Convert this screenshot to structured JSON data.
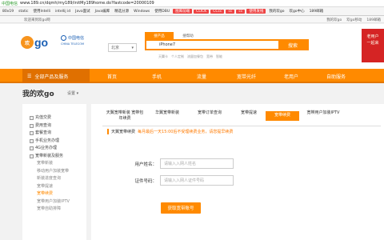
{
  "browser": {
    "secure_label": "中国电信",
    "url": "www.189.cn/dqmh/my189/initMy189home.do?fastcode=20000109",
    "bookmarks": [
      "80x19",
      "static",
      "使用Intelli",
      "intellij id",
      "Java面试",
      "Java编库",
      "精选分源",
      "Windows",
      "使用DBU",
      "图库前端",
      "CLICK",
      "CCcc",
      "cc",
      "cc",
      "使用发线",
      "我的欢go",
      "欢go中心",
      "189邮箱"
    ]
  },
  "topbar": {
    "welcome": "欢迎来到欢go网",
    "links": [
      "我的欢go",
      "欢go移动",
      "189邮箱"
    ]
  },
  "header": {
    "logo_o": "欢",
    "logo_go": "go",
    "carrier_line1": "中国电信",
    "carrier_line2": "CHINA TELECOM",
    "city": "北京",
    "search_tabs": [
      "搜产品",
      "搜帮助"
    ],
    "search_value": "iPhone7",
    "search_button": "搜索",
    "hot_words": [
      "天翼卡",
      "个人定制",
      "流量加餐包",
      "宽带",
      "智能"
    ],
    "promo": [
      "老用户",
      "一起来"
    ]
  },
  "nav": {
    "all_label": "全部产品及服务",
    "items": [
      "首页",
      "手机",
      "流量",
      "宽带光纤",
      "老用户",
      "自助服务"
    ]
  },
  "mygo": {
    "title": "我的欢go",
    "setting": "设置 ▾"
  },
  "sidebar": {
    "items": [
      {
        "label": "充值交费",
        "type": "item"
      },
      {
        "label": "费用查询",
        "type": "item"
      },
      {
        "label": "套餐查询",
        "type": "item"
      },
      {
        "label": "手机业务办理",
        "type": "item"
      },
      {
        "label": "4G业务办理",
        "type": "item"
      },
      {
        "label": "宽带新装及服务",
        "type": "item"
      },
      {
        "label": "宽带新装",
        "type": "sub"
      },
      {
        "label": "移动用户加装宽带",
        "type": "sub"
      },
      {
        "label": "新装进度查询",
        "type": "sub"
      },
      {
        "label": "宽带提速",
        "type": "sub"
      },
      {
        "label": "宽带续费",
        "type": "sub-active"
      },
      {
        "label": "宽带用户加装IPTV",
        "type": "sub"
      },
      {
        "label": "宽带自助排障",
        "type": "sub"
      }
    ]
  },
  "main": {
    "tabs": [
      "天翼宽带新装 宽带包年续费",
      "华翼宽带新装",
      "宽带订单查询",
      "宽带提速",
      "宽带续费",
      "宽带用户加装IPTV"
    ],
    "active_tab": 4,
    "notice_title": "天翼宽带续费",
    "notice_text": "每月最后一天15:00后不受理续费业务，请您提早续费",
    "username_label": "用户姓名：",
    "username_placeholder": "请输入入网人姓名",
    "id_label": "证件号码：",
    "id_placeholder": "请输入入网人证件号码",
    "submit": "获取宽带账号"
  }
}
